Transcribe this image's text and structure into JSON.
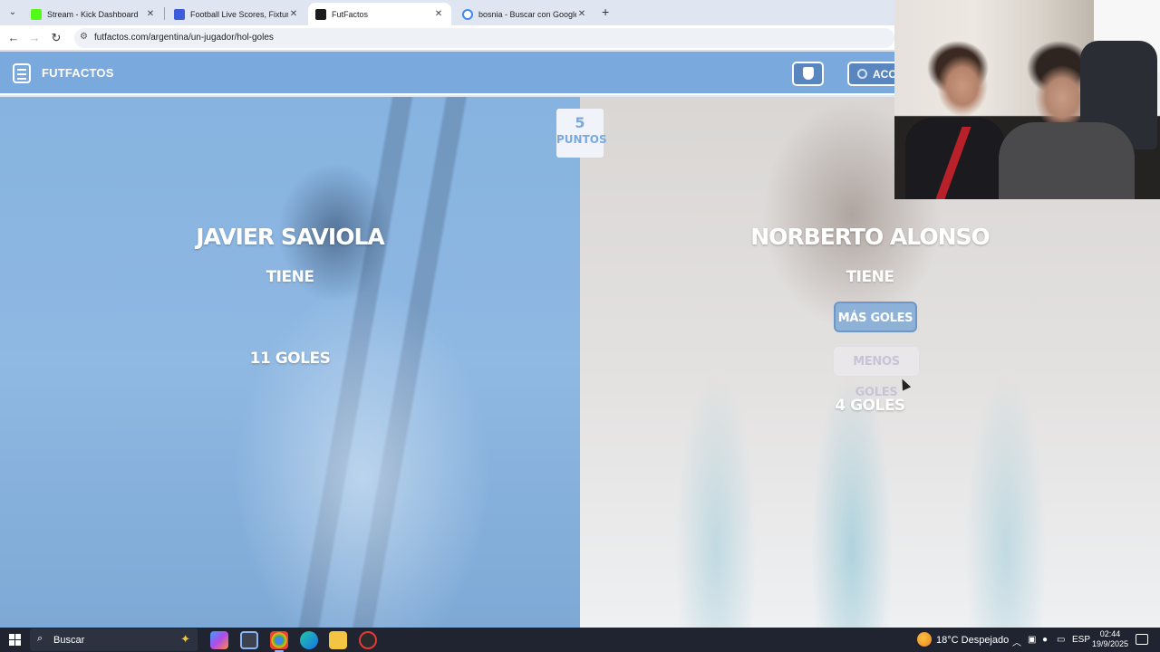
{
  "browser": {
    "tabs": [
      {
        "title": "Stream - Kick Dashboard",
        "favicon_color": "#53fc18",
        "active": false
      },
      {
        "title": "Football Live Scores, Fixtures & ",
        "favicon_color": "#3b5bdb",
        "active": false
      },
      {
        "title": "FutFactos",
        "favicon_color": "#1b1b1b",
        "active": true
      },
      {
        "title": "bosnia - Buscar con Google",
        "favicon_color": "#4285f4",
        "active": false
      }
    ],
    "url": "futfactos.com/argentina/un-jugador/hol-goles"
  },
  "site": {
    "logo_text": "FUTFACTOS",
    "login_label": "ACCE",
    "accent_color": "#7aa9dd"
  },
  "score": {
    "value": "5",
    "label": "PUNTOS"
  },
  "left_player": {
    "name": "JAVIER SAVIOLA",
    "tiene": "TIENE",
    "goals": "11 GOLES"
  },
  "right_player": {
    "name": "NORBERTO ALONSO",
    "tiene": "TIENE",
    "more_button": "MÁS GOLES",
    "less_button": "MENOS GOLES",
    "goals": "4 GOLES"
  },
  "taskbar": {
    "search_placeholder": "Buscar",
    "weather": "18°C  Despejado",
    "language": "ESP",
    "time": "02:44",
    "date": "19/9/2025"
  }
}
